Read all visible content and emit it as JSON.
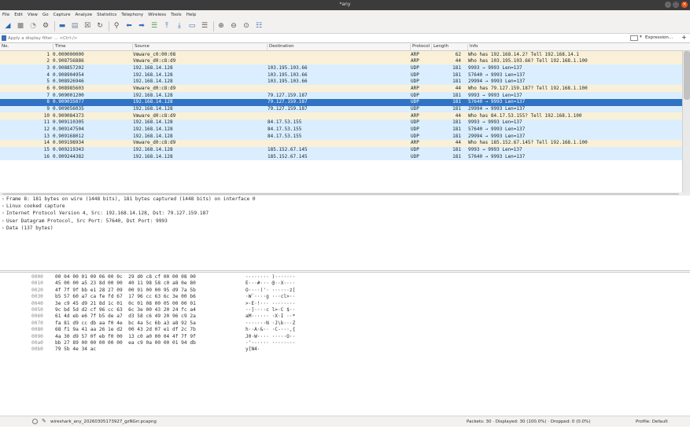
{
  "window": {
    "title": "*any",
    "min_glyph": "–",
    "max_glyph": "□",
    "close_glyph": "×"
  },
  "menu": [
    "File",
    "Edit",
    "View",
    "Go",
    "Capture",
    "Analyze",
    "Statistics",
    "Telephony",
    "Wireless",
    "Tools",
    "Help"
  ],
  "toolbar": {
    "icons": [
      {
        "name": "start-capture-icon",
        "glyph": "◢",
        "color": "#1f63b6"
      },
      {
        "name": "stop-capture-icon",
        "glyph": "■",
        "color": "#9a9a9a"
      },
      {
        "name": "restart-capture-icon",
        "glyph": "◔",
        "color": "#9a9a9a"
      },
      {
        "name": "capture-options-icon",
        "glyph": "⚙",
        "color": "#555555"
      },
      {
        "name": "sep",
        "glyph": "",
        "color": ""
      },
      {
        "name": "open-file-icon",
        "glyph": "▬",
        "color": "#3b6fb6"
      },
      {
        "name": "save-file-icon",
        "glyph": "▤",
        "color": "#7a8a9a"
      },
      {
        "name": "close-file-icon",
        "glyph": "☒",
        "color": "#555555"
      },
      {
        "name": "reload-file-icon",
        "glyph": "↻",
        "color": "#555555"
      },
      {
        "name": "sep",
        "glyph": "",
        "color": ""
      },
      {
        "name": "find-packet-icon",
        "glyph": "⚲",
        "color": "#555555"
      },
      {
        "name": "go-back-icon",
        "glyph": "⬅",
        "color": "#3b6fb6"
      },
      {
        "name": "go-forward-icon",
        "glyph": "➡",
        "color": "#3b6fb6"
      },
      {
        "name": "go-to-packet-icon",
        "glyph": "☰",
        "color": "#4a9a4a"
      },
      {
        "name": "go-first-icon",
        "glyph": "⤒",
        "color": "#3b6fb6"
      },
      {
        "name": "go-last-icon",
        "glyph": "⤓",
        "color": "#3b6fb6"
      },
      {
        "name": "autoscroll-icon",
        "glyph": "▭",
        "color": "#3b6fb6"
      },
      {
        "name": "colorize-icon",
        "glyph": "☰",
        "color": "#555555"
      },
      {
        "name": "sep",
        "glyph": "",
        "color": ""
      },
      {
        "name": "zoom-in-icon",
        "glyph": "⊕",
        "color": "#555555"
      },
      {
        "name": "zoom-out-icon",
        "glyph": "⊖",
        "color": "#555555"
      },
      {
        "name": "normal-size-icon",
        "glyph": "⊙",
        "color": "#555555"
      },
      {
        "name": "resize-columns-icon",
        "glyph": "☷",
        "color": "#3b6fb6"
      }
    ]
  },
  "filter": {
    "placeholder": "Apply a display filter … <Ctrl-/>",
    "dropdown_glyph": "▾",
    "expression_label": "Expression…",
    "plus_label": "+"
  },
  "columns": {
    "no": "No.",
    "time": "Time",
    "source": "Source",
    "destination": "Destination",
    "protocol": "Protocol",
    "length": "Length",
    "info": "Info"
  },
  "packets": [
    {
      "no": "1",
      "time": "0.000000000",
      "src": "Vmware_c0:00:08",
      "dst": "",
      "proto": "ARP",
      "len": "62",
      "info": "Who has 192.168.14.2? Tell 192.168.14.1",
      "kind": "arp"
    },
    {
      "no": "2",
      "time": "0.908756886",
      "src": "Vmware_d0:c8:d9",
      "dst": "",
      "proto": "ARP",
      "len": "44",
      "info": "Who has 103.195.103.66? Tell 192.168.1.100",
      "kind": "arp"
    },
    {
      "no": "3",
      "time": "0.908857202",
      "src": "192.168.14.128",
      "dst": "103.195.103.66",
      "proto": "UDP",
      "len": "181",
      "info": "9993 → 9993 Len=137",
      "kind": "udp"
    },
    {
      "no": "4",
      "time": "0.908904954",
      "src": "192.168.14.128",
      "dst": "103.195.103.66",
      "proto": "UDP",
      "len": "181",
      "info": "57640 → 9993 Len=137",
      "kind": "udp"
    },
    {
      "no": "5",
      "time": "0.908926946",
      "src": "192.168.14.128",
      "dst": "103.195.103.66",
      "proto": "UDP",
      "len": "181",
      "info": "29994 → 9993 Len=137",
      "kind": "udp"
    },
    {
      "no": "6",
      "time": "0.908985603",
      "src": "Vmware_d0:c8:d9",
      "dst": "",
      "proto": "ARP",
      "len": "44",
      "info": "Who has 79.127.159.187? Tell 192.168.1.100",
      "kind": "arp"
    },
    {
      "no": "7",
      "time": "0.909001200",
      "src": "192.168.14.128",
      "dst": "79.127.159.187",
      "proto": "UDP",
      "len": "181",
      "info": "9993 → 9993 Len=137",
      "kind": "udp"
    },
    {
      "no": "8",
      "time": "0.909035077",
      "src": "192.168.14.128",
      "dst": "79.127.159.187",
      "proto": "UDP",
      "len": "181",
      "info": "57640 → 9993 Len=137",
      "kind": "sel"
    },
    {
      "no": "9",
      "time": "0.909056035",
      "src": "192.168.14.128",
      "dst": "79.127.159.187",
      "proto": "UDP",
      "len": "181",
      "info": "29994 → 9993 Len=137",
      "kind": "udp"
    },
    {
      "no": "10",
      "time": "0.909084373",
      "src": "Vmware_d0:c8:d9",
      "dst": "",
      "proto": "ARP",
      "len": "44",
      "info": "Who has 84.17.53.155? Tell 192.168.1.100",
      "kind": "arp"
    },
    {
      "no": "11",
      "time": "0.909110305",
      "src": "192.168.14.128",
      "dst": "84.17.53.155",
      "proto": "UDP",
      "len": "181",
      "info": "9993 → 9993 Len=137",
      "kind": "udp"
    },
    {
      "no": "12",
      "time": "0.909147504",
      "src": "192.168.14.128",
      "dst": "84.17.53.155",
      "proto": "UDP",
      "len": "181",
      "info": "57640 → 9993 Len=137",
      "kind": "udp"
    },
    {
      "no": "13",
      "time": "0.909168012",
      "src": "192.168.14.128",
      "dst": "84.17.53.155",
      "proto": "UDP",
      "len": "181",
      "info": "29994 → 9993 Len=137",
      "kind": "udp"
    },
    {
      "no": "14",
      "time": "0.909198934",
      "src": "Vmware_d0:c8:d9",
      "dst": "",
      "proto": "ARP",
      "len": "44",
      "info": "Who has 185.152.67.145? Tell 192.168.1.100",
      "kind": "arp"
    },
    {
      "no": "15",
      "time": "0.909219343",
      "src": "192.168.14.128",
      "dst": "185.152.67.145",
      "proto": "UDP",
      "len": "181",
      "info": "9993 → 9993 Len=137",
      "kind": "udp"
    },
    {
      "no": "16",
      "time": "0.909244382",
      "src": "192.168.14.128",
      "dst": "185.152.67.145",
      "proto": "UDP",
      "len": "181",
      "info": "57640 → 9993 Len=137",
      "kind": "udp"
    }
  ],
  "details": [
    "Frame 8: 181 bytes on wire (1448 bits), 181 bytes captured (1448 bits) on interface 0",
    "Linux cooked capture",
    "Internet Protocol Version 4, Src: 192.168.14.128, Dst: 79.127.159.187",
    "User Datagram Protocol, Src Port: 57640, Dst Port: 9993",
    "Data (137 bytes)"
  ],
  "detail_arrow": "›",
  "hexdump": [
    {
      "off": "0000",
      "hex": "00 04 00 01 00 06 00 0c  29 d0 c8 cf 00 00 08 00",
      "ascii": "········ )·······"
    },
    {
      "off": "0010",
      "hex": "45 00 00 a5 23 8d 00 00  40 11 98 58 c0 a8 0e 80",
      "ascii": "E···#··· @··X····"
    },
    {
      "off": "0020",
      "hex": "4f 7f 9f bb e1 28 27 09  00 91 00 00 95 d9 7a 5b",
      "ascii": "O····('· ······z["
    },
    {
      "off": "0030",
      "hex": "b5 57 60 a7 ca fe fd 67  17 96 cc 63 6c 3e 00 b6",
      "ascii": "·W`····g ···cl>··"
    },
    {
      "off": "0040",
      "hex": "3e c9 45 d9 21 8d 1c 01  0c 01 08 00 05 00 00 01",
      "ascii": ">·E·!··· ········"
    },
    {
      "off": "0050",
      "hex": "9c bd 5d d2 cf 96 cc 63  6c 3e 00 43 20 24 fc a4",
      "ascii": "··]····c l>·C $··"
    },
    {
      "off": "0060",
      "hex": "61 4d eb e6 7f b5 de a7  d3 58 c6 49 20 96 c9 2a",
      "ascii": "aM······ ·X·I ··*"
    },
    {
      "off": "0070",
      "hex": "fa 81 d9 cc db aa f0 4e  bc 4a 5c 6b a3 a8 92 5a",
      "ascii": "·······N ·J\\k···Z"
    },
    {
      "off": "0080",
      "hex": "68 f1 9a 41 aa 26 1e d2  00 43 2d 07 e1 df 2c 7b",
      "ascii": "h··A·&·· ·C-···,{"
    },
    {
      "off": "0090",
      "hex": "4a 30 d9 57 0f eb f0 00  13 c0 a0 00 04 4f 7f 9f",
      "ascii": "J0·W···· ·····O··"
    },
    {
      "off": "00a0",
      "hex": "bb 27 89 00 00 00 00 00  ea c9 0a 00 00 01 94 db",
      "ascii": "·'······ ········"
    },
    {
      "off": "00b0",
      "hex": "79 5b 4e 34 ac",
      "ascii": "y[N4·"
    }
  ],
  "status": {
    "file": "wireshark_any_20260305173927_gzNGrr.pcapng",
    "stats": "Packets: 30 · Displayed: 30 (100.0%) · Dropped: 0 (0.0%)",
    "profile": "Profile: Default",
    "expert_glyph": "✎"
  },
  "colors": {
    "arp_row": "#faf0d7",
    "udp_row": "#daeeff",
    "selected_row": "#3073c4",
    "titlebar": "#3b3b3b",
    "close_button": "#e95420"
  }
}
